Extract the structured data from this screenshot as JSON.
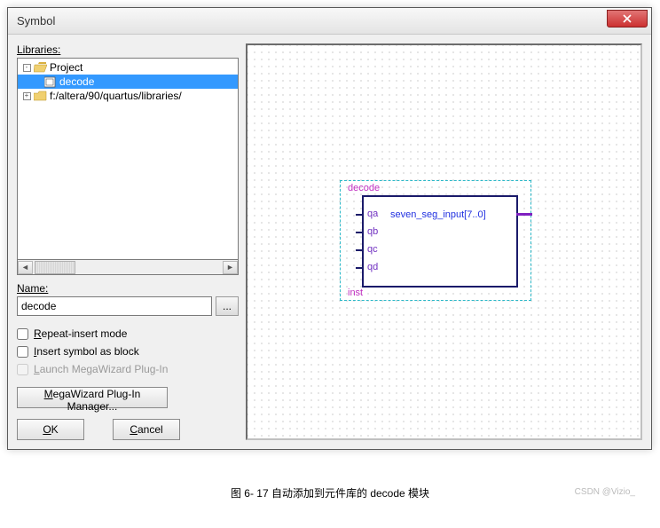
{
  "window": {
    "title": "Symbol"
  },
  "labels": {
    "libraries": "Libraries:",
    "name": "Name:",
    "browse": "..."
  },
  "tree": {
    "root": {
      "expander": "-",
      "label": "Project"
    },
    "child": {
      "label": "decode"
    },
    "lib": {
      "expander": "+",
      "label": "f:/altera/90/quartus/libraries/"
    }
  },
  "name_value": "decode",
  "checks": {
    "repeat_u": "R",
    "repeat_rest": "epeat-insert mode",
    "block_u": "I",
    "block_rest": "nsert symbol as block",
    "launch_u": "L",
    "launch_rest": "aunch MegaWizard Plug-In"
  },
  "buttons": {
    "mega_u": "M",
    "mega_rest": "egaWizard Plug-In Manager...",
    "ok_u": "O",
    "ok_rest": "K",
    "cancel_u": "C",
    "cancel_rest": "ancel"
  },
  "symbol": {
    "title": "decode",
    "inst": "inst",
    "ports": [
      "qa",
      "qb",
      "qc",
      "qd"
    ],
    "output": "seven_seg_input[7..0]"
  },
  "caption": "图 6- 17 自动添加到元件库的 decode 模块",
  "watermark": "CSDN @Vizio_"
}
